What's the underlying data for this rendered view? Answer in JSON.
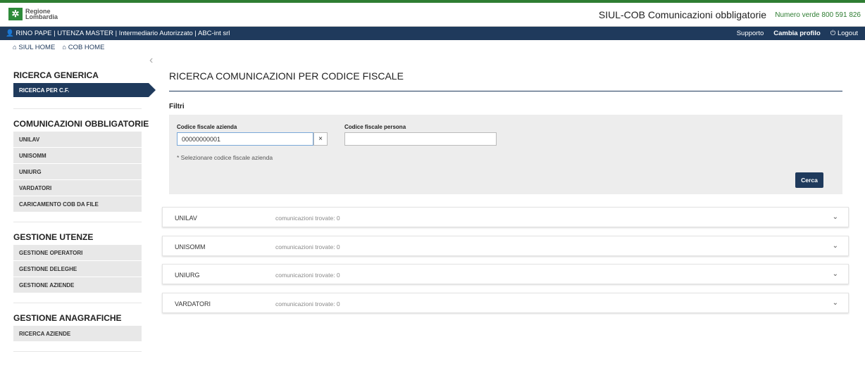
{
  "header": {
    "logo_line1": "Regione",
    "logo_line2": "Lombardia",
    "app_title": "SIUL-COB Comunicazioni obbligatorie",
    "green_number": "Numero verde 800 591 826"
  },
  "userbar": {
    "user_info": "RINO PAPE | UTENZA MASTER | Intermediario Autorizzato | ABC-int srl",
    "support": "Supporto",
    "change_profile": "Cambia profilo",
    "logout": "Logout"
  },
  "breadcrumbs": {
    "siul_home": "SIUL HOME",
    "cob_home": "COB HOME"
  },
  "sidebar": {
    "sec1": "RICERCA GENERICA",
    "sec1_active": "RICERCA PER C.F.",
    "sec2": "COMUNICAZIONI OBBLIGATORIE",
    "sec2_items": [
      "UNILAV",
      "UNISOMM",
      "UNIURG",
      "VARDATORI",
      "CARICAMENTO COB DA FILE"
    ],
    "sec3": "GESTIONE UTENZE",
    "sec3_items": [
      "GESTIONE OPERATORI",
      "GESTIONE DELEGHE",
      "GESTIONE AZIENDE"
    ],
    "sec4": "GESTIONE ANAGRAFICHE",
    "sec4_items": [
      "RICERCA AZIENDE"
    ]
  },
  "main": {
    "title": "RICERCA COMUNICAZIONI PER CODICE FISCALE",
    "filters_label": "Filtri",
    "cf_azienda_label": "Codice fiscale azienda",
    "cf_azienda_value": "00000000001",
    "clear": "×",
    "cf_persona_label": "Codice fiscale persona",
    "cf_persona_value": "",
    "hint": "* Selezionare codice fiscale azienda",
    "search_button": "Cerca",
    "results": [
      {
        "name": "UNILAV",
        "count": "comunicazioni trovate: 0"
      },
      {
        "name": "UNISOMM",
        "count": "comunicazioni trovate: 0"
      },
      {
        "name": "UNIURG",
        "count": "comunicazioni trovate: 0"
      },
      {
        "name": "VARDATORI",
        "count": "comunicazioni trovate: 0"
      }
    ]
  }
}
